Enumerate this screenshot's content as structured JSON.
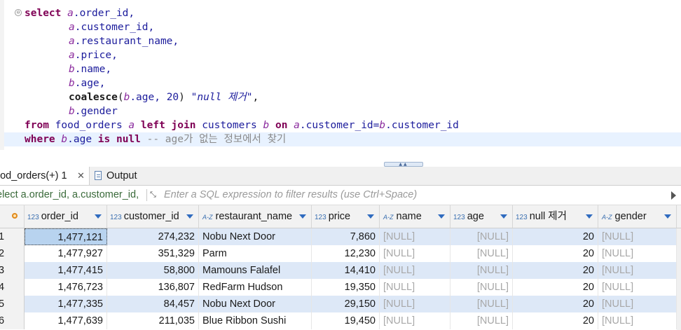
{
  "editor": {
    "fold_glyph": "⊖",
    "lines": [
      {
        "kw": "select ",
        "al": "a",
        "rest": ".order_id,"
      },
      {
        "al": "a",
        "rest": ".customer_id,"
      },
      {
        "al": "a",
        "rest": ".restaurant_name,"
      },
      {
        "al": "a",
        "rest": ".price,"
      },
      {
        "al": "b",
        "rest": ".name,"
      },
      {
        "al": "b",
        "rest": ".age,"
      },
      {
        "fn": "coalesce",
        "p1": "(",
        "al": "b",
        "rest": ".age, ",
        "num": "20",
        ") ": ") ",
        "str": "\"null 제거\"",
        "end": ","
      },
      {
        "al": "b",
        "rest": ".gender"
      }
    ],
    "from_line": {
      "kw1": "from",
      "tb": " food_orders ",
      "al1": "a",
      "kw2": " left join",
      "tb2": " customers ",
      "al2": "b",
      "kw3": " on ",
      "al3": "a",
      "c1": ".customer_id=",
      "al4": "b",
      "c2": ".customer_id"
    },
    "where_line": {
      "kw1": "where ",
      "al": "b",
      "c": ".age ",
      "kw2": "is null",
      "cmt": " -- age가 없는 정보에서 찾기"
    }
  },
  "tabs": {
    "results_label": "ood_orders(+) 1",
    "close_glyph": "✕",
    "output_label": "Output"
  },
  "filter": {
    "query_text": "elect a.order_id, a.customer_id,",
    "placeholder": "Enter a SQL expression to filter results (use Ctrl+Space)"
  },
  "grid": {
    "columns": [
      {
        "type": "123",
        "name": "order_id"
      },
      {
        "type": "123",
        "name": "customer_id"
      },
      {
        "type": "A-Z",
        "name": "restaurant_name"
      },
      {
        "type": "123",
        "name": "price"
      },
      {
        "type": "A-Z",
        "name": "name"
      },
      {
        "type": "123",
        "name": "age"
      },
      {
        "type": "123",
        "name": "null 제거"
      },
      {
        "type": "A-Z",
        "name": "gender"
      }
    ],
    "rows": [
      {
        "n": "1",
        "order_id": "1,477,121",
        "customer_id": "274,232",
        "restaurant_name": "Nobu Next Door",
        "price": "7,860",
        "name": "[NULL]",
        "age": "[NULL]",
        "null_removed": "20",
        "gender": "[NULL]"
      },
      {
        "n": "2",
        "order_id": "1,477,927",
        "customer_id": "351,329",
        "restaurant_name": "Parm",
        "price": "12,230",
        "name": "[NULL]",
        "age": "[NULL]",
        "null_removed": "20",
        "gender": "[NULL]"
      },
      {
        "n": "3",
        "order_id": "1,477,415",
        "customer_id": "58,800",
        "restaurant_name": "Mamouns Falafel",
        "price": "14,410",
        "name": "[NULL]",
        "age": "[NULL]",
        "null_removed": "20",
        "gender": "[NULL]"
      },
      {
        "n": "4",
        "order_id": "1,476,723",
        "customer_id": "136,807",
        "restaurant_name": "RedFarm Hudson",
        "price": "19,350",
        "name": "[NULL]",
        "age": "[NULL]",
        "null_removed": "20",
        "gender": "[NULL]"
      },
      {
        "n": "5",
        "order_id": "1,477,335",
        "customer_id": "84,457",
        "restaurant_name": "Nobu Next Door",
        "price": "29,150",
        "name": "[NULL]",
        "age": "[NULL]",
        "null_removed": "20",
        "gender": "[NULL]"
      },
      {
        "n": "6",
        "order_id": "1,477,639",
        "customer_id": "211,035",
        "restaurant_name": "Blue Ribbon Sushi",
        "price": "19,450",
        "name": "[NULL]",
        "age": "[NULL]",
        "null_removed": "20",
        "gender": "[NULL]"
      }
    ]
  }
}
